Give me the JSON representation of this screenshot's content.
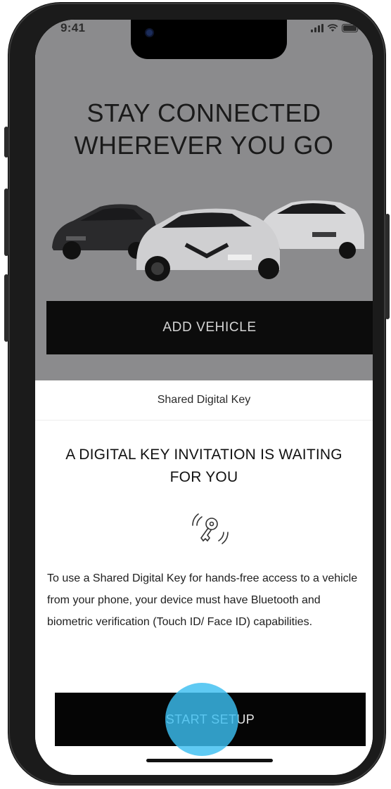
{
  "status_bar": {
    "time": "9:41",
    "icons": [
      "signal-icon",
      "wifi-icon",
      "battery-icon"
    ]
  },
  "hero": {
    "title_line1": "STAY CONNECTED",
    "title_line2": "WHEREVER YOU GO",
    "image": "three-vehicles-illustration",
    "add_vehicle_label": "ADD VEHICLE"
  },
  "sheet": {
    "header": "Shared Digital Key",
    "title_line1": "A DIGITAL KEY INVITATION IS WAITING",
    "title_line2": "FOR YOU",
    "icon": "digital-key-icon",
    "description": "To use a Shared Digital Key for hands-free access to a vehicle from your phone, your device must have Bluetooth and biometric verification (Touch ID/ Face ID) capabilities.",
    "start_setup_label": "START SETUP"
  },
  "colors": {
    "hero_overlay": "#8b8b8d",
    "button_bg": "#050505",
    "tap_indicator": "#3cbef0"
  }
}
